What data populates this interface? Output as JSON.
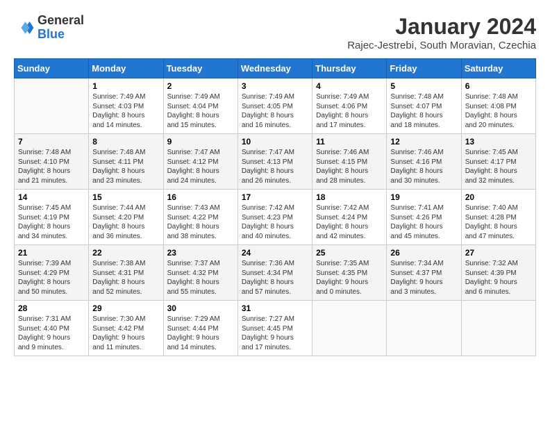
{
  "header": {
    "logo_general": "General",
    "logo_blue": "Blue",
    "month_title": "January 2024",
    "subtitle": "Rajec-Jestrebi, South Moravian, Czechia"
  },
  "weekdays": [
    "Sunday",
    "Monday",
    "Tuesday",
    "Wednesday",
    "Thursday",
    "Friday",
    "Saturday"
  ],
  "weeks": [
    [
      {
        "day": "",
        "info": ""
      },
      {
        "day": "1",
        "info": "Sunrise: 7:49 AM\nSunset: 4:03 PM\nDaylight: 8 hours\nand 14 minutes."
      },
      {
        "day": "2",
        "info": "Sunrise: 7:49 AM\nSunset: 4:04 PM\nDaylight: 8 hours\nand 15 minutes."
      },
      {
        "day": "3",
        "info": "Sunrise: 7:49 AM\nSunset: 4:05 PM\nDaylight: 8 hours\nand 16 minutes."
      },
      {
        "day": "4",
        "info": "Sunrise: 7:49 AM\nSunset: 4:06 PM\nDaylight: 8 hours\nand 17 minutes."
      },
      {
        "day": "5",
        "info": "Sunrise: 7:48 AM\nSunset: 4:07 PM\nDaylight: 8 hours\nand 18 minutes."
      },
      {
        "day": "6",
        "info": "Sunrise: 7:48 AM\nSunset: 4:08 PM\nDaylight: 8 hours\nand 20 minutes."
      }
    ],
    [
      {
        "day": "7",
        "info": "Sunrise: 7:48 AM\nSunset: 4:10 PM\nDaylight: 8 hours\nand 21 minutes."
      },
      {
        "day": "8",
        "info": "Sunrise: 7:48 AM\nSunset: 4:11 PM\nDaylight: 8 hours\nand 23 minutes."
      },
      {
        "day": "9",
        "info": "Sunrise: 7:47 AM\nSunset: 4:12 PM\nDaylight: 8 hours\nand 24 minutes."
      },
      {
        "day": "10",
        "info": "Sunrise: 7:47 AM\nSunset: 4:13 PM\nDaylight: 8 hours\nand 26 minutes."
      },
      {
        "day": "11",
        "info": "Sunrise: 7:46 AM\nSunset: 4:15 PM\nDaylight: 8 hours\nand 28 minutes."
      },
      {
        "day": "12",
        "info": "Sunrise: 7:46 AM\nSunset: 4:16 PM\nDaylight: 8 hours\nand 30 minutes."
      },
      {
        "day": "13",
        "info": "Sunrise: 7:45 AM\nSunset: 4:17 PM\nDaylight: 8 hours\nand 32 minutes."
      }
    ],
    [
      {
        "day": "14",
        "info": "Sunrise: 7:45 AM\nSunset: 4:19 PM\nDaylight: 8 hours\nand 34 minutes."
      },
      {
        "day": "15",
        "info": "Sunrise: 7:44 AM\nSunset: 4:20 PM\nDaylight: 8 hours\nand 36 minutes."
      },
      {
        "day": "16",
        "info": "Sunrise: 7:43 AM\nSunset: 4:22 PM\nDaylight: 8 hours\nand 38 minutes."
      },
      {
        "day": "17",
        "info": "Sunrise: 7:42 AM\nSunset: 4:23 PM\nDaylight: 8 hours\nand 40 minutes."
      },
      {
        "day": "18",
        "info": "Sunrise: 7:42 AM\nSunset: 4:24 PM\nDaylight: 8 hours\nand 42 minutes."
      },
      {
        "day": "19",
        "info": "Sunrise: 7:41 AM\nSunset: 4:26 PM\nDaylight: 8 hours\nand 45 minutes."
      },
      {
        "day": "20",
        "info": "Sunrise: 7:40 AM\nSunset: 4:28 PM\nDaylight: 8 hours\nand 47 minutes."
      }
    ],
    [
      {
        "day": "21",
        "info": "Sunrise: 7:39 AM\nSunset: 4:29 PM\nDaylight: 8 hours\nand 50 minutes."
      },
      {
        "day": "22",
        "info": "Sunrise: 7:38 AM\nSunset: 4:31 PM\nDaylight: 8 hours\nand 52 minutes."
      },
      {
        "day": "23",
        "info": "Sunrise: 7:37 AM\nSunset: 4:32 PM\nDaylight: 8 hours\nand 55 minutes."
      },
      {
        "day": "24",
        "info": "Sunrise: 7:36 AM\nSunset: 4:34 PM\nDaylight: 8 hours\nand 57 minutes."
      },
      {
        "day": "25",
        "info": "Sunrise: 7:35 AM\nSunset: 4:35 PM\nDaylight: 9 hours\nand 0 minutes."
      },
      {
        "day": "26",
        "info": "Sunrise: 7:34 AM\nSunset: 4:37 PM\nDaylight: 9 hours\nand 3 minutes."
      },
      {
        "day": "27",
        "info": "Sunrise: 7:32 AM\nSunset: 4:39 PM\nDaylight: 9 hours\nand 6 minutes."
      }
    ],
    [
      {
        "day": "28",
        "info": "Sunrise: 7:31 AM\nSunset: 4:40 PM\nDaylight: 9 hours\nand 9 minutes."
      },
      {
        "day": "29",
        "info": "Sunrise: 7:30 AM\nSunset: 4:42 PM\nDaylight: 9 hours\nand 11 minutes."
      },
      {
        "day": "30",
        "info": "Sunrise: 7:29 AM\nSunset: 4:44 PM\nDaylight: 9 hours\nand 14 minutes."
      },
      {
        "day": "31",
        "info": "Sunrise: 7:27 AM\nSunset: 4:45 PM\nDaylight: 9 hours\nand 17 minutes."
      },
      {
        "day": "",
        "info": ""
      },
      {
        "day": "",
        "info": ""
      },
      {
        "day": "",
        "info": ""
      }
    ]
  ]
}
